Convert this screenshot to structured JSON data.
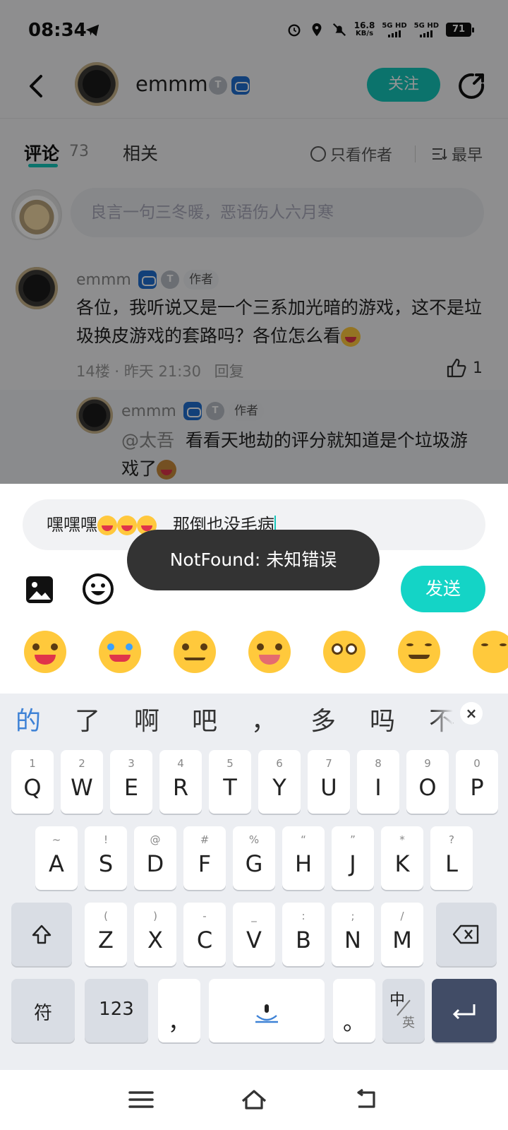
{
  "status_bar": {
    "time": "08:34",
    "net_speed_value": "16.8",
    "net_speed_unit": "KB/s",
    "sim1": "5G HD",
    "sim2": "5G HD",
    "battery": "71"
  },
  "header": {
    "title": "emmm",
    "follow_label": "关注",
    "badge_t": "T"
  },
  "tabs": {
    "comments_label": "评论",
    "comments_count": "73",
    "related_label": "相关",
    "only_author_label": "只看作者",
    "sort_label": "最早"
  },
  "comment_box": {
    "placeholder": "良言一句三冬暖，恶语伤人六月寒"
  },
  "comments": [
    {
      "name": "emmm",
      "author_tag": "作者",
      "text": "各位，我听说又是一个三系加光暗的游戏，这不是垃圾换皮游戏的套路吗？各位怎么看",
      "floor": "14楼",
      "time": "昨天 21:30",
      "reply_label": "回复",
      "likes": "1"
    }
  ],
  "reply": {
    "name": "emmm",
    "author_tag": "作者",
    "mention": "@太吾",
    "text": "看看天地劫的评分就知道是个垃圾游戏了"
  },
  "input_sheet": {
    "value_prefix": "嘿嘿嘿",
    "value_suffix": "那倒也没毛病",
    "send_label": "发送"
  },
  "toast": {
    "message": "NotFound: 未知错误"
  },
  "keyboard": {
    "candidates": [
      "的",
      "了",
      "啊",
      "吧",
      "，",
      "多",
      "吗",
      "不"
    ],
    "row1": [
      {
        "hint": "1",
        "key": "Q"
      },
      {
        "hint": "2",
        "key": "W"
      },
      {
        "hint": "3",
        "key": "E"
      },
      {
        "hint": "4",
        "key": "R"
      },
      {
        "hint": "5",
        "key": "T"
      },
      {
        "hint": "6",
        "key": "Y"
      },
      {
        "hint": "7",
        "key": "U"
      },
      {
        "hint": "8",
        "key": "I"
      },
      {
        "hint": "9",
        "key": "O"
      },
      {
        "hint": "0",
        "key": "P"
      }
    ],
    "row2": [
      {
        "hint": "~",
        "key": "A"
      },
      {
        "hint": "!",
        "key": "S"
      },
      {
        "hint": "@",
        "key": "D"
      },
      {
        "hint": "#",
        "key": "F"
      },
      {
        "hint": "%",
        "key": "G"
      },
      {
        "hint": "“",
        "key": "H"
      },
      {
        "hint": "”",
        "key": "J"
      },
      {
        "hint": "*",
        "key": "K"
      },
      {
        "hint": "?",
        "key": "L"
      }
    ],
    "row3": [
      {
        "hint": "(",
        "key": "Z"
      },
      {
        "hint": ")",
        "key": "X"
      },
      {
        "hint": "-",
        "key": "C"
      },
      {
        "hint": "_",
        "key": "V"
      },
      {
        "hint": ":",
        "key": "B"
      },
      {
        "hint": ";",
        "key": "N"
      },
      {
        "hint": "/",
        "key": "M"
      }
    ],
    "symbols_label": "符",
    "numbers_label": "123",
    "comma": "，",
    "period": "。",
    "lang_top": "中",
    "lang_bottom": "英"
  }
}
